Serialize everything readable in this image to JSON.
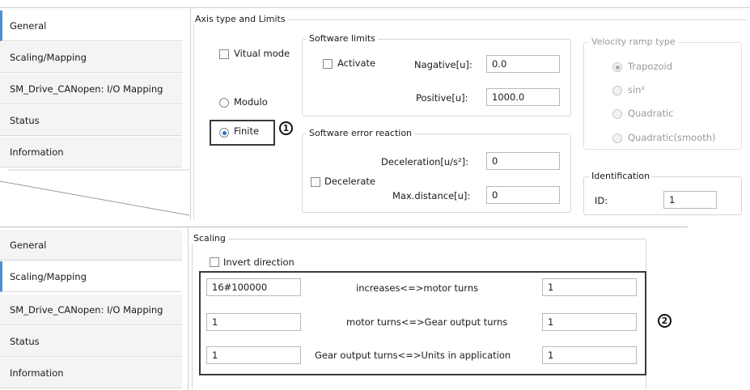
{
  "tabs": [
    "General",
    "Scaling/Mapping",
    "SM_Drive_CANopen: I/O Mapping",
    "Status",
    "Information"
  ],
  "top": {
    "axis_group_title": "Axis type and Limits",
    "virtual_mode": "Vitual mode",
    "modulo": "Modulo",
    "finite": "Finite",
    "software_limits": {
      "title": "Software limits",
      "activate": "Activate",
      "negative_label": "Nagative[u]:",
      "negative_value": "0.0",
      "positive_label": "Positive[u]:",
      "positive_value": "1000.0"
    },
    "software_error": {
      "title": "Software error reaction",
      "decelerate": "Decelerate",
      "deceleration_label": "Deceleration[u/s²]:",
      "deceleration_value": "0",
      "maxdist_label": "Max.distance[u]:",
      "maxdist_value": "0"
    },
    "velocity_ramp": {
      "title": "Velocity ramp type",
      "options": [
        "Trapozoid",
        "sin²",
        "Quadratic",
        "Quadratic(smooth)"
      ],
      "selected": "Trapozoid"
    },
    "identification": {
      "title": "Identification",
      "id_label": "ID:",
      "id_value": "1"
    },
    "callout": "1"
  },
  "bottom": {
    "scaling_title": "Scaling",
    "invert_direction": "Invert direction",
    "rows": [
      {
        "left": "16#100000",
        "label": "increases<=>motor turns",
        "right": "1"
      },
      {
        "left": "1",
        "label": "motor turns<=>Gear output turns",
        "right": "1"
      },
      {
        "left": "1",
        "label": "Gear output turns<=>Units in application",
        "right": "1"
      }
    ],
    "callout": "2"
  },
  "colors": {
    "accent": "#4a90d9",
    "radio_selected": "#2a73c6",
    "disabled_text": "#9a9a9a"
  }
}
